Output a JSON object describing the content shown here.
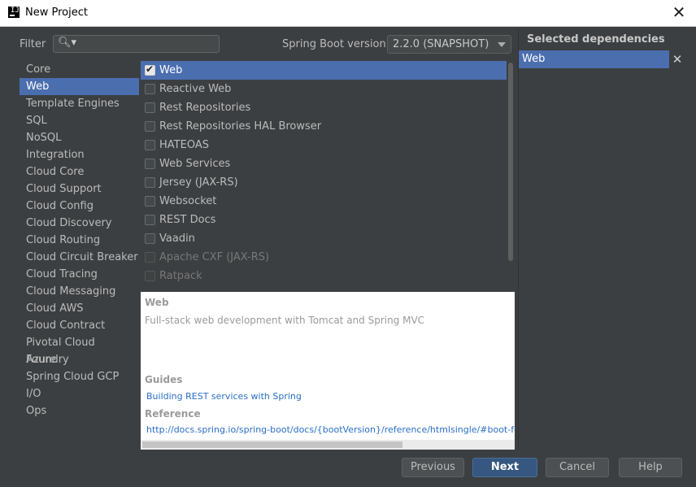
{
  "window": {
    "title": "New Project",
    "app_icon_label": "IJ"
  },
  "filter": {
    "label": "Filter",
    "value": ""
  },
  "spring_boot": {
    "label": "Spring Boot version",
    "selected": "2.2.0 (SNAPSHOT)"
  },
  "categories": [
    "Core",
    "Web",
    "Template Engines",
    "SQL",
    "NoSQL",
    "Integration",
    "Cloud Core",
    "Cloud Support",
    "Cloud Config",
    "Cloud Discovery",
    "Cloud Routing",
    "Cloud Circuit Breaker",
    "Cloud Tracing",
    "Cloud Messaging",
    "Cloud AWS",
    "Cloud Contract",
    "Pivotal Cloud Foundry",
    "Azure",
    "Spring Cloud GCP",
    "I/O",
    "Ops"
  ],
  "selected_category": "Web",
  "dependencies": [
    {
      "label": "Web",
      "checked": true,
      "disabled": false
    },
    {
      "label": "Reactive Web",
      "checked": false,
      "disabled": false
    },
    {
      "label": "Rest Repositories",
      "checked": false,
      "disabled": false
    },
    {
      "label": "Rest Repositories HAL Browser",
      "checked": false,
      "disabled": false
    },
    {
      "label": "HATEOAS",
      "checked": false,
      "disabled": false
    },
    {
      "label": "Web Services",
      "checked": false,
      "disabled": false
    },
    {
      "label": "Jersey (JAX-RS)",
      "checked": false,
      "disabled": false
    },
    {
      "label": "Websocket",
      "checked": false,
      "disabled": false
    },
    {
      "label": "REST Docs",
      "checked": false,
      "disabled": false
    },
    {
      "label": "Vaadin",
      "checked": false,
      "disabled": false
    },
    {
      "label": "Apache CXF (JAX-RS)",
      "checked": false,
      "disabled": true
    },
    {
      "label": "Ratpack",
      "checked": false,
      "disabled": true
    }
  ],
  "description": {
    "title": "Web",
    "text": "Full-stack web development with Tomcat and Spring MVC",
    "guides_label": "Guides",
    "guide_link": "Building REST services with Spring",
    "reference_label": "Reference",
    "reference_link": "http://docs.spring.io/spring-boot/docs/{bootVersion}/reference/htmlsingle/#boot-fea"
  },
  "selected_panel": {
    "title": "Selected dependencies",
    "items": [
      "Web"
    ]
  },
  "buttons": {
    "previous": "Previous",
    "next": "Next",
    "cancel": "Cancel",
    "help": "Help"
  },
  "colors": {
    "accent": "#4b6eaf",
    "background": "#3c3f41",
    "link": "#2a6fc5",
    "primary_button": "#365880"
  }
}
